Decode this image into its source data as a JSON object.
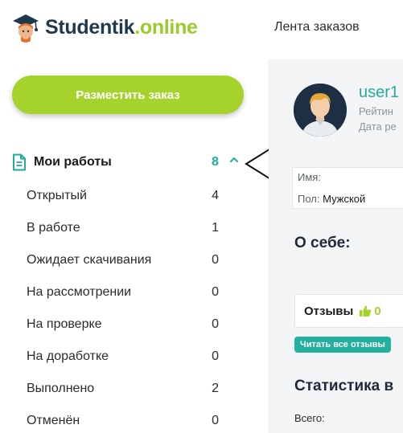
{
  "header": {
    "logo_part1": "Studentik",
    "logo_part2": ".online",
    "nav_link": "Лента заказов"
  },
  "sidebar": {
    "place_order_label": "Разместить заказ",
    "works": {
      "title": "Мои работы",
      "count": "8",
      "statuses": [
        {
          "label": "Открытый",
          "count": "4"
        },
        {
          "label": "В работе",
          "count": "1"
        },
        {
          "label": "Ожидает скачивания",
          "count": "0"
        },
        {
          "label": "На рассмотрении",
          "count": "0"
        },
        {
          "label": "На проверке",
          "count": "0"
        },
        {
          "label": "На доработке",
          "count": "0"
        },
        {
          "label": "Выполнено",
          "count": "2"
        },
        {
          "label": "Отменён",
          "count": "0"
        }
      ]
    }
  },
  "profile": {
    "username": "user1",
    "rating_label": "Рейтин",
    "date_label": "Дата ре",
    "name_label": "Имя:",
    "gender_label": "Пол:",
    "gender_value": "Мужской",
    "about_title": "О себе:",
    "reviews_label": "Отзывы",
    "reviews_count": "0",
    "read_all_reviews": "Читать все отзывы",
    "stats_title": "Статистика в",
    "total_label": "Всего:"
  },
  "colors": {
    "brand_green": "#a6d32b",
    "teal": "#1eaf9a",
    "navy": "#1f3a4d"
  }
}
